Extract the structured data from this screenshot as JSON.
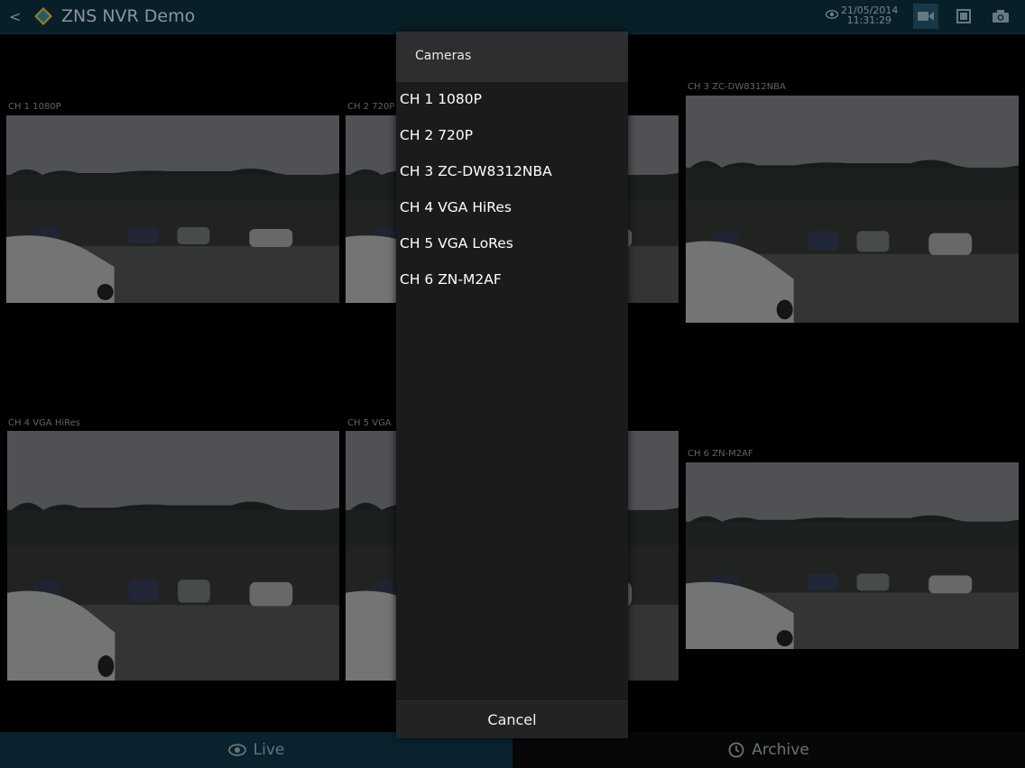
{
  "app": {
    "title": "ZNS NVR Demo",
    "date": "21/05/2014",
    "time": "11:31:29"
  },
  "grid": {
    "cameras": [
      {
        "label": "CH 1 1080P"
      },
      {
        "label": "CH 2 720P"
      },
      {
        "label": "CH 3 ZC-DW8312NBA"
      },
      {
        "label": "CH 4 VGA HiRes"
      },
      {
        "label": "CH 5 VGA"
      },
      {
        "label": "CH 6 ZN-M2AF"
      }
    ]
  },
  "dialog": {
    "title": "Cameras",
    "items": [
      "CH 1 1080P",
      "CH 2 720P",
      "CH 3 ZC-DW8312NBA",
      "CH 4 VGA HiRes",
      "CH 5 VGA LoRes",
      "CH 6 ZN-M2AF"
    ],
    "cancel": "Cancel"
  },
  "tabs": {
    "live": "Live",
    "archive": "Archive"
  },
  "icons": [
    "back-icon",
    "app-logo-icon",
    "eye-icon",
    "video-camera-icon",
    "stop-icon",
    "camera-snapshot-icon",
    "clock-icon"
  ],
  "colors": {
    "topbar": "#0d2a36",
    "live_tab": "#0c2e3c",
    "dialog": "#1b1b1d"
  }
}
